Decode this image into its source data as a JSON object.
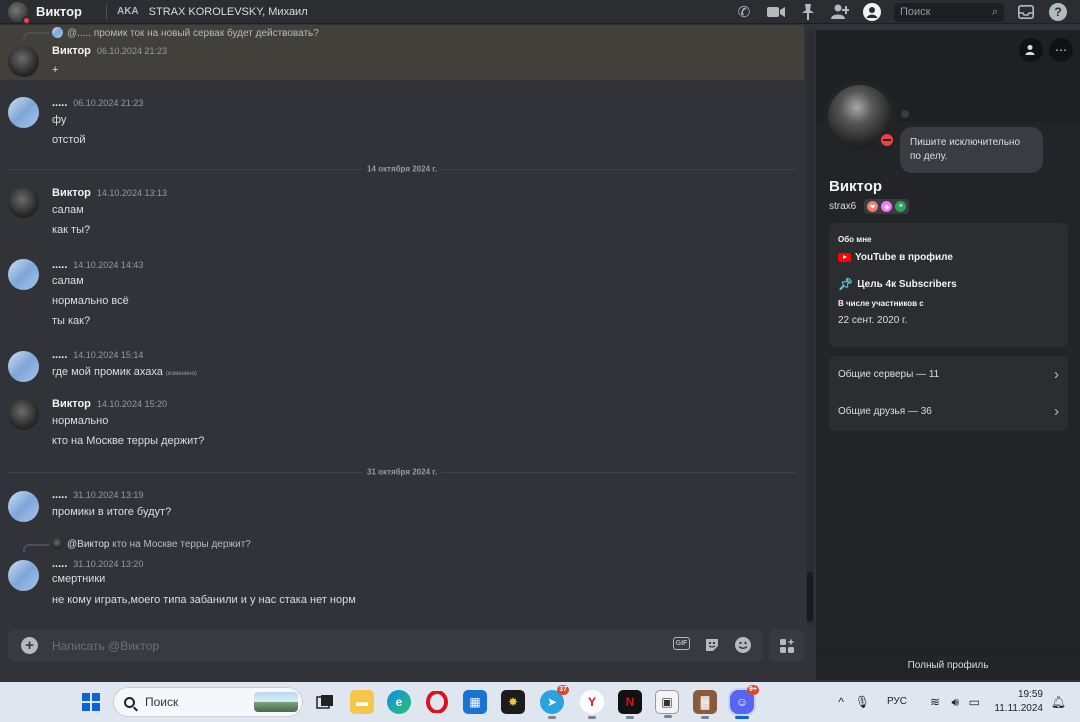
{
  "topbar": {
    "channel_name": "Виктор",
    "aka_label": "AKA",
    "aka_names": "STRAX KOROLEVSKY, Михаил",
    "search_placeholder": "Поиск"
  },
  "chat": {
    "top_reply": "@..... промик ток на новый сервак будет действовать?",
    "messages": [
      {
        "author": "Виктор",
        "time": "06.10.2024 21:23",
        "lines": [
          "+"
        ]
      },
      {
        "author": ".....",
        "time": "06.10.2024 21:23",
        "lines": [
          "фу",
          "отстой"
        ]
      },
      {
        "author": "Виктор",
        "time": "14.10.2024 13:13",
        "lines": [
          "салам",
          "как ты?"
        ]
      },
      {
        "author": ".....",
        "time": "14.10.2024 14:43",
        "lines": [
          "салам",
          "нормально всё",
          "ты как?"
        ]
      },
      {
        "author": ".....",
        "time": "14.10.2024 15:14",
        "lines": [
          "где мой промик ахаха"
        ],
        "edited": "(изменено)"
      },
      {
        "author": "Виктор",
        "time": "14.10.2024 15:20",
        "lines": [
          "нормально",
          "кто на Москве терры держит?"
        ]
      },
      {
        "author": ".....",
        "time": "31.10.2024 13:19",
        "lines": [
          "промики в итоге будут?"
        ]
      },
      {
        "author": ".....",
        "time": "31.10.2024 13:20",
        "lines": [
          "смертники",
          "не кому играть,моего типа забанили и у нас стака нет норм"
        ]
      }
    ],
    "dividers": [
      "14 октября 2024 г.",
      "31 октября 2024 г."
    ],
    "reply_to": {
      "mention": "@Виктор",
      "text": "кто на Москве терры держит?"
    },
    "composer_placeholder": "Написать @Виктор",
    "gif_label": "GIF"
  },
  "profile": {
    "custom_status": "Пишите исключительно по делу.",
    "display_name": "Виктор",
    "username": "strax6",
    "about_heading": "Обо мне",
    "about_line1": "YouTube в профиле",
    "about_line2": "Цель 4к Subscribers",
    "member_since_heading": "В числе участников с",
    "member_since": "22 сент. 2020 г.",
    "mutual_servers": "Общие серверы — 11",
    "mutual_friends": "Общие друзья — 36",
    "full_profile": "Полный профиль"
  },
  "taskbar": {
    "search_label": "Поиск",
    "telegram_count": "37",
    "discord_count": "9+",
    "language": "РУС",
    "time": "19:59",
    "date": "11.11.2024"
  }
}
